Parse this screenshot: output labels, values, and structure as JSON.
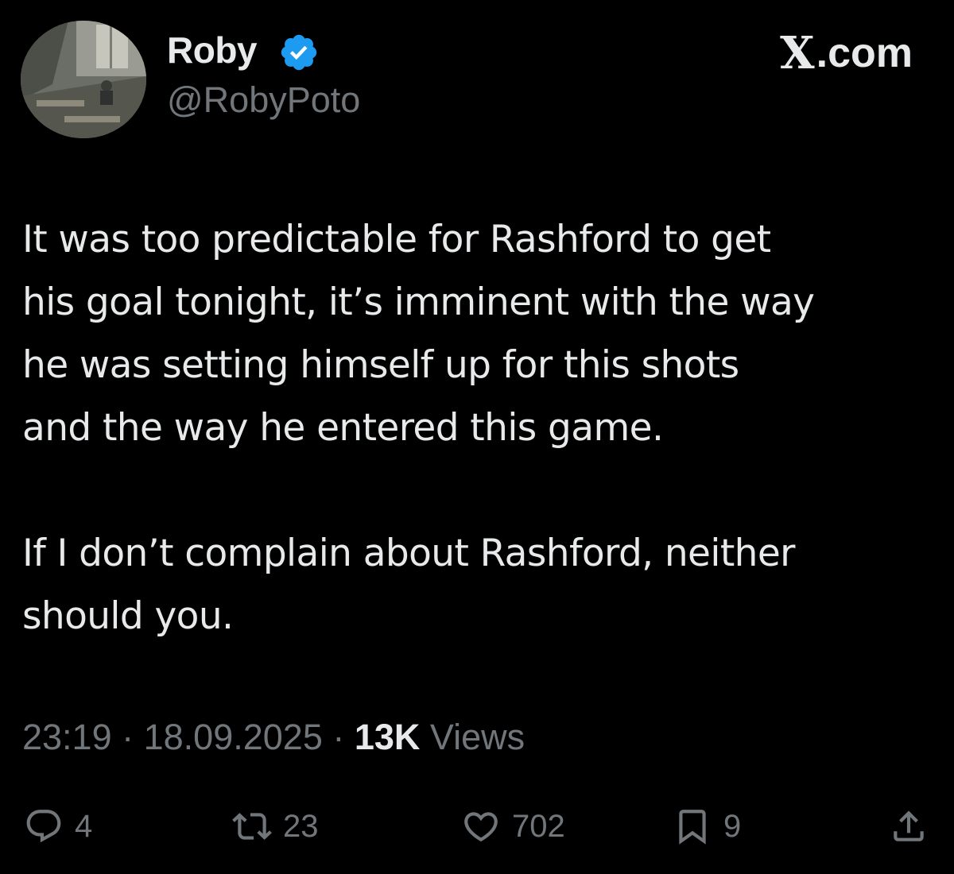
{
  "author": {
    "display_name": "Roby",
    "handle": "@RobyPoto",
    "verified_icon": "verified-badge-icon",
    "badge_color": "#1d9bf0"
  },
  "brand": {
    "label": ".com",
    "logo": "X"
  },
  "tweet": {
    "paragraph_1": "It was too predictable for Rashford to get\nhis goal tonight, it’s imminent with the way\nhe was setting himself up for this shots\nand the way he entered this game.",
    "paragraph_2": "If I don’t complain about Rashford, neither\nshould you."
  },
  "meta": {
    "time": "23:19",
    "separator": " · ",
    "date": "18.09.2025",
    "views_count": "13K",
    "views_label": " Views"
  },
  "actions": {
    "reply": {
      "icon": "reply-icon",
      "count": "4"
    },
    "repost": {
      "icon": "repost-icon",
      "count": "23"
    },
    "like": {
      "icon": "heart-icon",
      "count": "702"
    },
    "bookmark": {
      "icon": "bookmark-icon",
      "count": "9"
    },
    "share": {
      "icon": "share-icon"
    }
  },
  "colors": {
    "background": "#000000",
    "text": "#e7e9ea",
    "secondary": "#71767b"
  }
}
